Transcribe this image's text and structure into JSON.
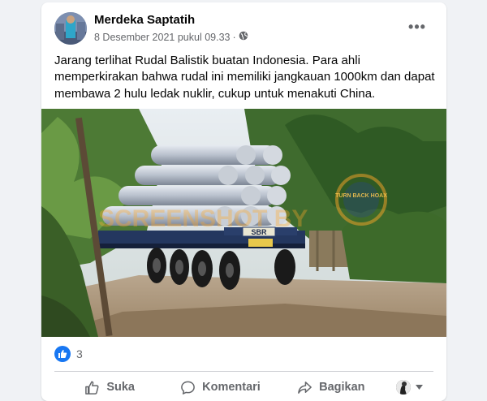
{
  "post": {
    "author": "Merdeka Saptatih",
    "timestamp": "8 Desember 2021 pukul 09.33",
    "separator": "·",
    "audience_icon": "globe-icon",
    "text": "Jarang terlihat Rudal Balistik buatan Indonesia. Para ahli memperkirakan bahwa rudal ini memiliki jangkauan 1000km dan dapat membawa 2 hulu ledak nuklir, cukup untuk menakuti China.",
    "image": {
      "watermark": "SCREENSHOT BY",
      "truck_plate": "SBR",
      "stamp_text": "TURN BACK HOAX"
    }
  },
  "reactions": {
    "icon": "like-icon",
    "count": "3"
  },
  "actions": [
    {
      "label": "Suka",
      "icon": "thumbs-up-icon"
    },
    {
      "label": "Komentari",
      "icon": "comment-icon"
    },
    {
      "label": "Bagikan",
      "icon": "share-icon"
    }
  ],
  "colors": {
    "brand": "#1877f2",
    "secondary_text": "#65676b"
  }
}
